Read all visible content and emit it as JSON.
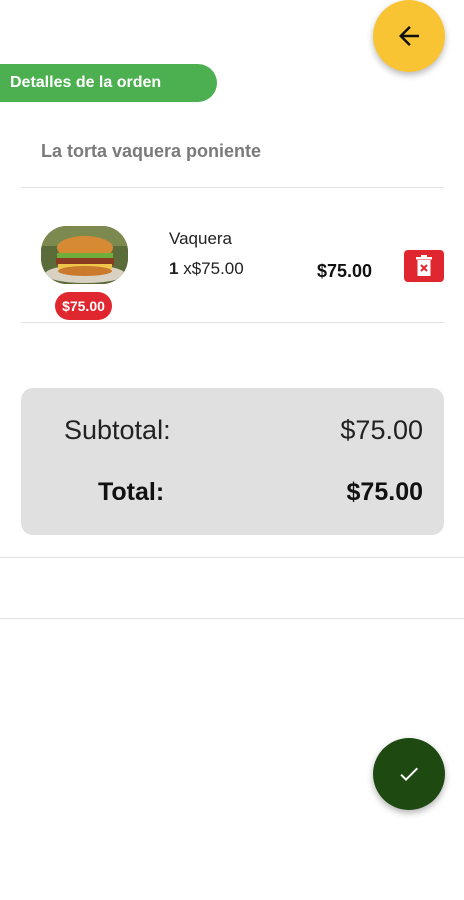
{
  "header": {
    "back_icon": "arrow-left-icon",
    "back_color": "#f9c433"
  },
  "section": {
    "title": "Detalles de la orden",
    "color": "#4caf50"
  },
  "store": {
    "name": "La torta vaquera poniente"
  },
  "order_items": [
    {
      "name": "Vaquera",
      "quantity": "1",
      "unit_price": "x$75.00",
      "total": "$75.00",
      "price_badge": "$75.00",
      "image": "burger-photo",
      "delete_icon": "trash-icon"
    }
  ],
  "totals": {
    "subtotal_label": "Subtotal:",
    "subtotal_value": "$75.00",
    "total_label": "Total:",
    "total_value": "$75.00"
  },
  "confirm": {
    "icon": "check-icon",
    "color": "#1e4a12"
  },
  "colors": {
    "accent_red": "#e0262f",
    "card_gray": "#e0e0e0"
  }
}
